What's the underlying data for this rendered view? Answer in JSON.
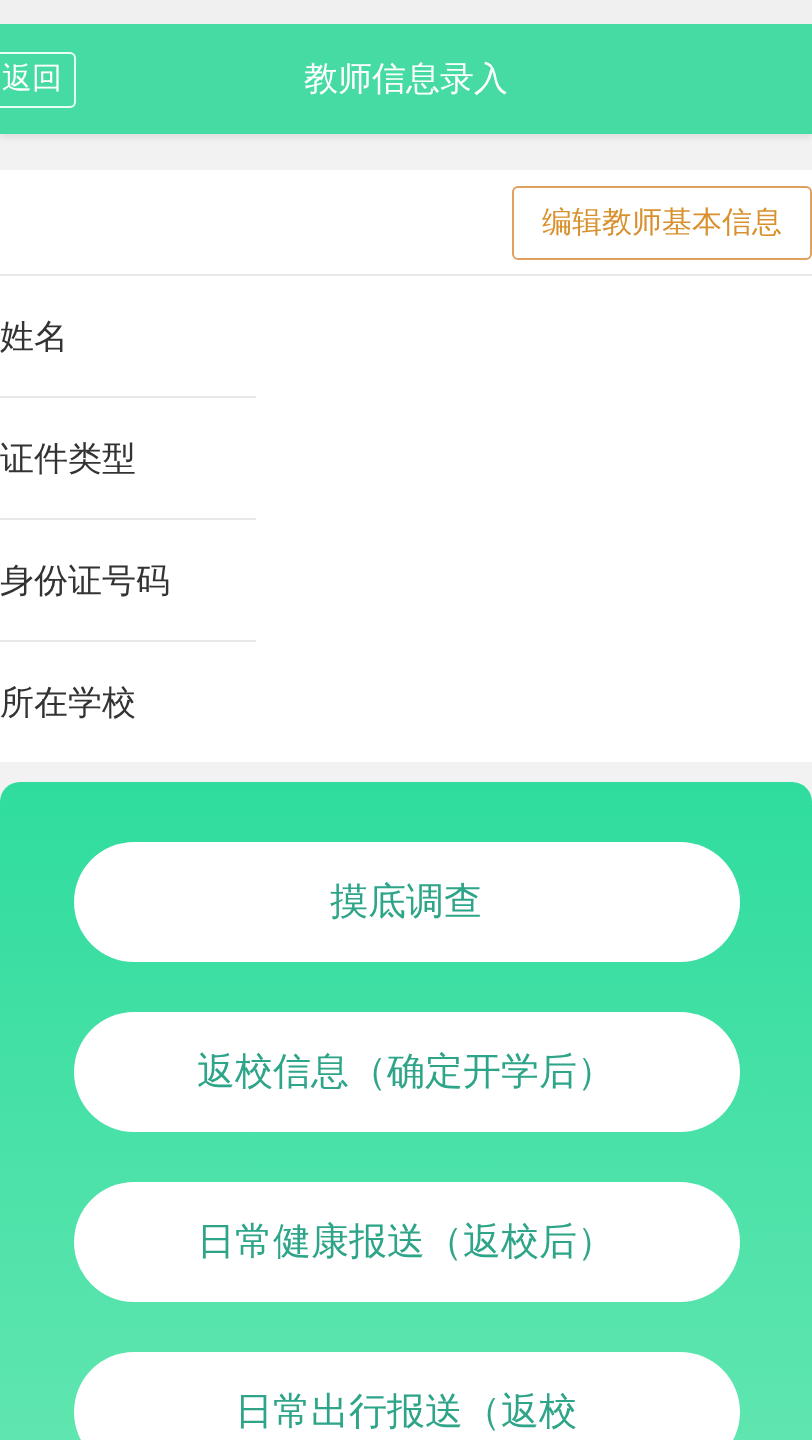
{
  "header": {
    "back_button": "返回",
    "title": "教师信息录入"
  },
  "edit_button": "编辑教师基本信息",
  "fields": [
    {
      "label": "姓名"
    },
    {
      "label": "证件类型"
    },
    {
      "label": "身份证号码"
    },
    {
      "label": "所在学校"
    }
  ],
  "actions": [
    {
      "label": "摸底调查"
    },
    {
      "label": "返校信息（确定开学后）"
    },
    {
      "label": "日常健康报送（返校后）"
    },
    {
      "label": "日常出行报送（返校"
    }
  ]
}
